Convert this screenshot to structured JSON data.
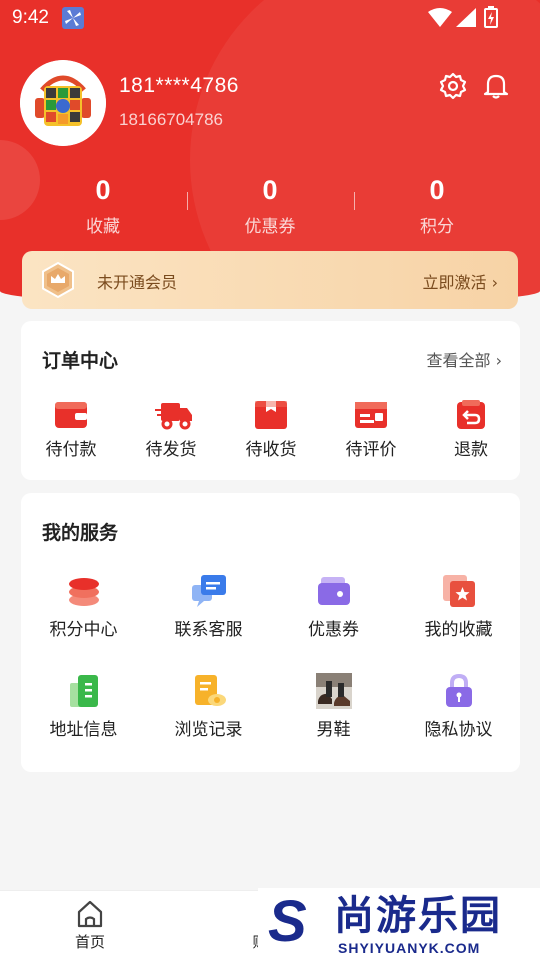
{
  "status_bar": {
    "time": "9:42"
  },
  "profile": {
    "masked_phone": "181****4786",
    "phone": "18166704786"
  },
  "stats": [
    {
      "value": "0",
      "label": "收藏"
    },
    {
      "value": "0",
      "label": "优惠券"
    },
    {
      "value": "0",
      "label": "积分"
    }
  ],
  "member": {
    "status": "未开通会员",
    "action": "立即激活"
  },
  "orders": {
    "title": "订单中心",
    "view_all": "查看全部",
    "items": [
      {
        "label": "待付款",
        "icon": "wallet-icon"
      },
      {
        "label": "待发货",
        "icon": "truck-icon"
      },
      {
        "label": "待收货",
        "icon": "package-icon"
      },
      {
        "label": "待评价",
        "icon": "review-icon"
      },
      {
        "label": "退款",
        "icon": "refund-icon"
      }
    ]
  },
  "services": {
    "title": "我的服务",
    "items": [
      {
        "label": "积分中心",
        "icon": "points-coins-icon"
      },
      {
        "label": "联系客服",
        "icon": "chat-bubble-icon"
      },
      {
        "label": "优惠券",
        "icon": "coupon-icon"
      },
      {
        "label": "我的收藏",
        "icon": "favorite-star-icon"
      },
      {
        "label": "地址信息",
        "icon": "address-book-icon"
      },
      {
        "label": "浏览记录",
        "icon": "history-doc-icon"
      },
      {
        "label": "男鞋",
        "icon": "shoes-thumbnail"
      },
      {
        "label": "隐私协议",
        "icon": "lock-icon"
      }
    ]
  },
  "tabbar": [
    {
      "label": "首页",
      "icon": "home-icon"
    },
    {
      "label": "购",
      "icon": "cart-icon"
    }
  ],
  "watermark": {
    "brand_cn": "尚游乐园",
    "brand_en": "SHYIYUANYK.COM",
    "letter": "S"
  },
  "colors": {
    "primary": "#e8302a",
    "member_text": "#7a4b1e",
    "watermark": "#1a2a8c"
  }
}
